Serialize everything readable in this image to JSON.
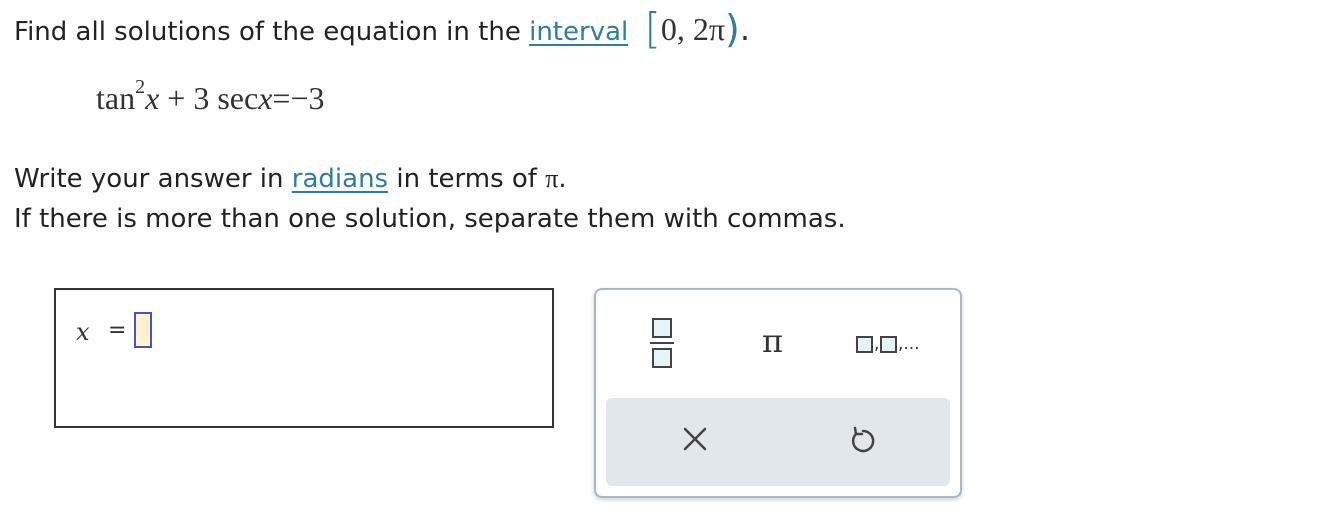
{
  "question": {
    "prompt_text": "Find all solutions of the equation in the",
    "interval_link": "interval",
    "interval": {
      "open_bracket": "[",
      "content": "0, 2π",
      "close_paren": ")",
      "period": "."
    },
    "equation": {
      "tan": "tan",
      "exponent": "2",
      "var1": "x",
      "plus": "+",
      "coef": "3",
      "sec": "sec",
      "var2": "x",
      "equals": "=",
      "rhs": "−3"
    },
    "instruction_before_link": "Write your answer in",
    "radians_link": "radians",
    "instruction_after_link": "in terms of",
    "pi_symbol": "π",
    "instruction_period": ".",
    "separation_note": "If there is more than one solution, separate them with commas."
  },
  "answer": {
    "variable": "x",
    "equals": "=",
    "value": ""
  },
  "palette": {
    "pi_label": "π",
    "list_label_comma": ",",
    "list_label_ellipsis": ",..."
  },
  "colors": {
    "link": "#2f7ea1",
    "slot_fill": "#fff2cc",
    "slot_border": "#4355c5",
    "action_bar": "#e1e7ea"
  }
}
